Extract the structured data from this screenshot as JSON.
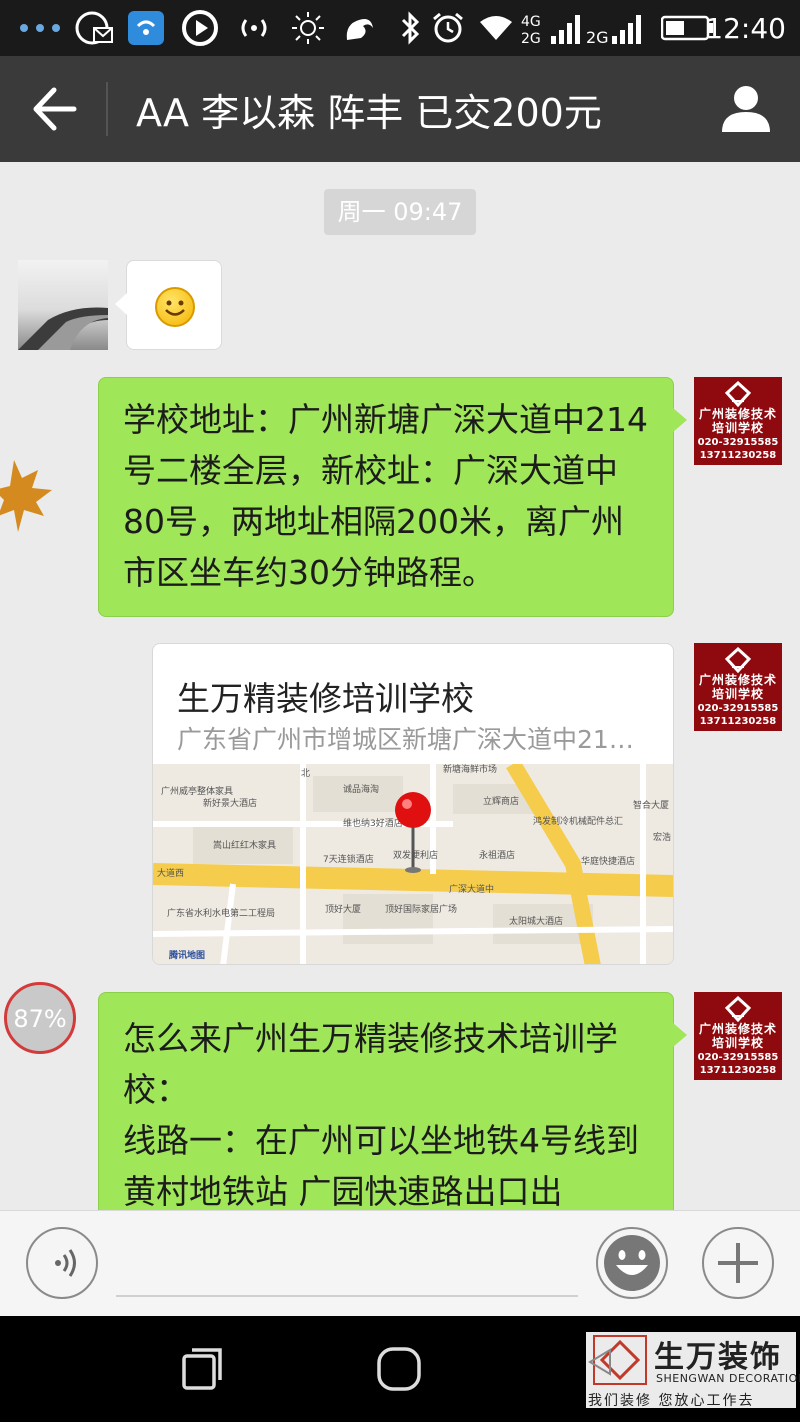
{
  "status_bar": {
    "time": "12:40",
    "signal_label_1": "4G",
    "signal_label_2": "2G",
    "icons": [
      "more-icon",
      "browser-icon",
      "mail-icon",
      "wifi-share-icon",
      "play-icon",
      "hotspot-icon",
      "brightness-icon",
      "squirrel-icon",
      "bluetooth-icon",
      "alarm-icon",
      "wifi-icon",
      "signal-icon",
      "battery-icon"
    ]
  },
  "header": {
    "title": "AA 李以森  阵丰  已交200元"
  },
  "chat": {
    "timestamp": "周一 09:47",
    "messages": [
      {
        "sender": "contact",
        "type": "emoji",
        "content": "smile-icon"
      },
      {
        "sender": "me",
        "type": "text",
        "text": "  学校地址：广州新塘广深大道中214号二楼全层，新校址：广深大道中80号，两地址相隔200米，离广州市区坐车约30分钟路程。"
      },
      {
        "sender": "me",
        "type": "location",
        "title": "生万精装修培训学校",
        "address": "广东省广州市增城区新塘广深大道中21…"
      },
      {
        "sender": "me",
        "type": "text",
        "text": "怎么来广州生万精装修技术培训学校：\n线路一：在广州可以坐地铁4号线到黄村地铁站 广园快速路出口出"
      }
    ],
    "upload_progress": "87%"
  },
  "school_avatar": {
    "name": "广州装修技术培训学校",
    "phone1": "020-32915585",
    "phone2": "13711230258"
  },
  "map": {
    "labels": [
      "北",
      "新塘海鲜市场",
      "广州威亭整体家具",
      "新好景大酒店",
      "诚品海淘",
      "立辉商店",
      "鸿发制冷机械配件总汇",
      "智合大厦",
      "宏浩",
      "嵩山红红木家具",
      "维也纳3好酒店",
      "7天连锁酒店",
      "双发便利店",
      "永祖酒店",
      "华庭快捷酒店",
      "大道西",
      "广深大道中",
      "顶好大厦",
      "顶好国际家居广场",
      "广东省水利水电第二工程局",
      "太阳城大酒店",
      "腾讯地图"
    ]
  },
  "input_bar": {
    "placeholder": ""
  },
  "watermark": {
    "brand": "生万装饰",
    "english": "SHENGWAN DECORATION",
    "slogan": "我们装修  您放心工作去"
  },
  "colors": {
    "bubble_green": "#9fe658",
    "title_bar": "#3a3a3a",
    "status_bar": "#1a1a1a",
    "chat_bg": "#ebebeb",
    "school_red": "#8e0a0e",
    "map_pin": "#e01010"
  }
}
